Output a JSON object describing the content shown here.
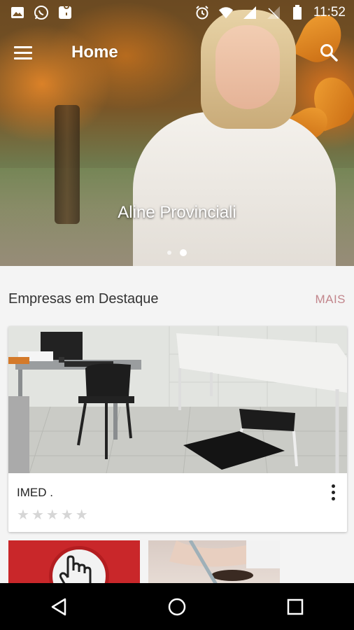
{
  "status_bar": {
    "time": "11:52",
    "left_icons": [
      "image-icon",
      "whatsapp-icon",
      "maps-icon"
    ],
    "right_icons": [
      "alarm-icon",
      "wifi-icon",
      "signal-icon",
      "no-signal-icon",
      "battery-icon"
    ]
  },
  "app_bar": {
    "title": "Home",
    "menu_icon": "menu-icon",
    "search_icon": "search-icon"
  },
  "hero": {
    "name": "Aline Provinciali",
    "slides": 2,
    "active_slide": 2
  },
  "featured": {
    "title": "Empresas em Destaque",
    "more_label": "MAIS",
    "items": [
      {
        "name": "IMED .",
        "rating": 0,
        "max_rating": 5
      }
    ]
  },
  "navigation": {
    "buttons": [
      "back-icon",
      "home-icon",
      "recents-icon"
    ]
  },
  "colors": {
    "accent_more": "#c2868c",
    "star_empty": "#d6d6d6",
    "nav_bg": "#000000"
  }
}
